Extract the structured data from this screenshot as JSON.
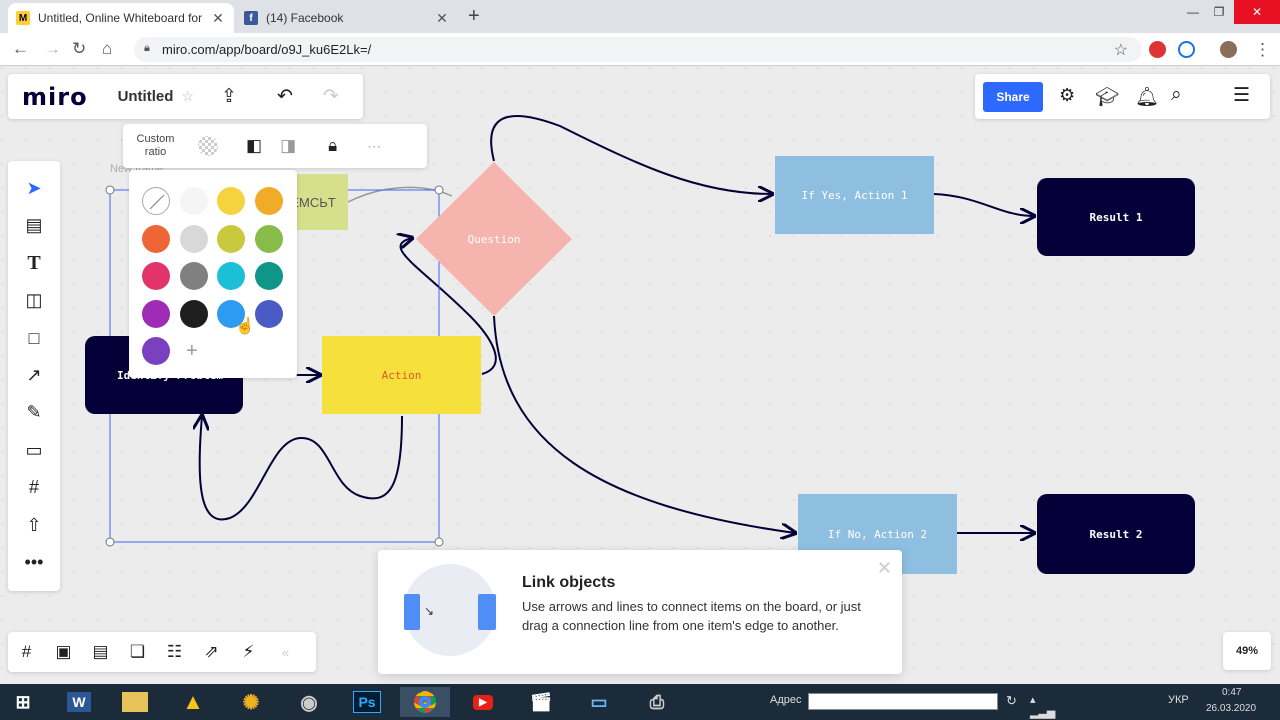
{
  "browser": {
    "tabs": [
      {
        "title": "Untitled, Online Whiteboard for",
        "favicon": "miro-icon",
        "color": "#ffd02f"
      },
      {
        "title": "(14) Facebook",
        "favicon": "facebook-icon",
        "color": "#3b5998"
      }
    ],
    "url": "miro.com/app/board/o9J_ku6E2Lk=/"
  },
  "app": {
    "logo": "miro",
    "board_title": "Untitled",
    "share_label": "Share",
    "zoom": "49%",
    "accent": "#2d68ff"
  },
  "context_toolbar": {
    "custom_ratio": "Custom\nratio"
  },
  "palette": {
    "colors": [
      [
        "transparent",
        "#f5f5f5",
        "#f5d33f",
        "#f0ac28"
      ],
      [
        "#ee6637",
        "#d8d8d8",
        "#c8c93d",
        "#88bc4a"
      ],
      [
        "#e2336b",
        "#808080",
        "#1bbfd6",
        "#0f9688"
      ],
      [
        "#9f2cb4",
        "#1e1e1e",
        "#2d9bf0",
        "#4a5bc6"
      ],
      [
        "#7a40c0"
      ]
    ]
  },
  "board": {
    "shapes": {
      "question": "Question",
      "if_yes": "If Yes, Action 1",
      "result1": "Result 1",
      "action": "Action",
      "problem": "Identify Problem",
      "if_no": "If No, Action 2",
      "result2": "Result 2",
      "sticky": "EMCЬT",
      "frame_label": "New frame"
    }
  },
  "tip": {
    "title": "Link objects",
    "text": "Use arrows and lines to connect items on the board, or just drag a connection line from one item's edge to another."
  },
  "taskbar": {
    "address_label": "Адрес",
    "lang": "УКР",
    "time": "0:47",
    "date": "26.03.2020"
  }
}
